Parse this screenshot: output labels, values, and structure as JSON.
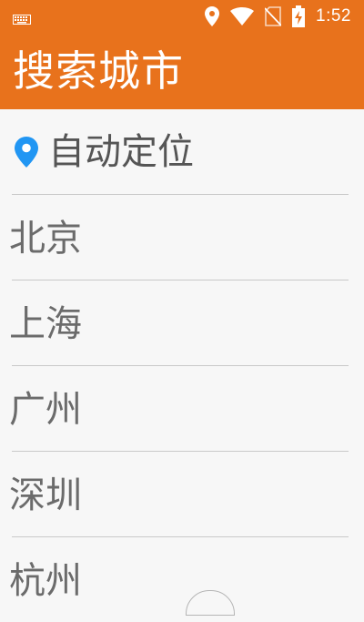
{
  "status_bar": {
    "time": "1:52",
    "icons": [
      "keyboard-icon",
      "location-pin-icon",
      "wifi-icon",
      "no-sim-icon",
      "battery-charging-icon"
    ]
  },
  "app_bar": {
    "title": "搜索城市"
  },
  "auto_locate": {
    "label": "自动定位",
    "icon": "location-pin-icon"
  },
  "cities": [
    {
      "name": "北京"
    },
    {
      "name": "上海"
    },
    {
      "name": "广州"
    },
    {
      "name": "深圳"
    },
    {
      "name": "杭州"
    }
  ],
  "colors": {
    "accent": "#e8721c",
    "pin": "#2196f3",
    "text": "#6b6b6b",
    "divider": "#c9c9c9"
  }
}
